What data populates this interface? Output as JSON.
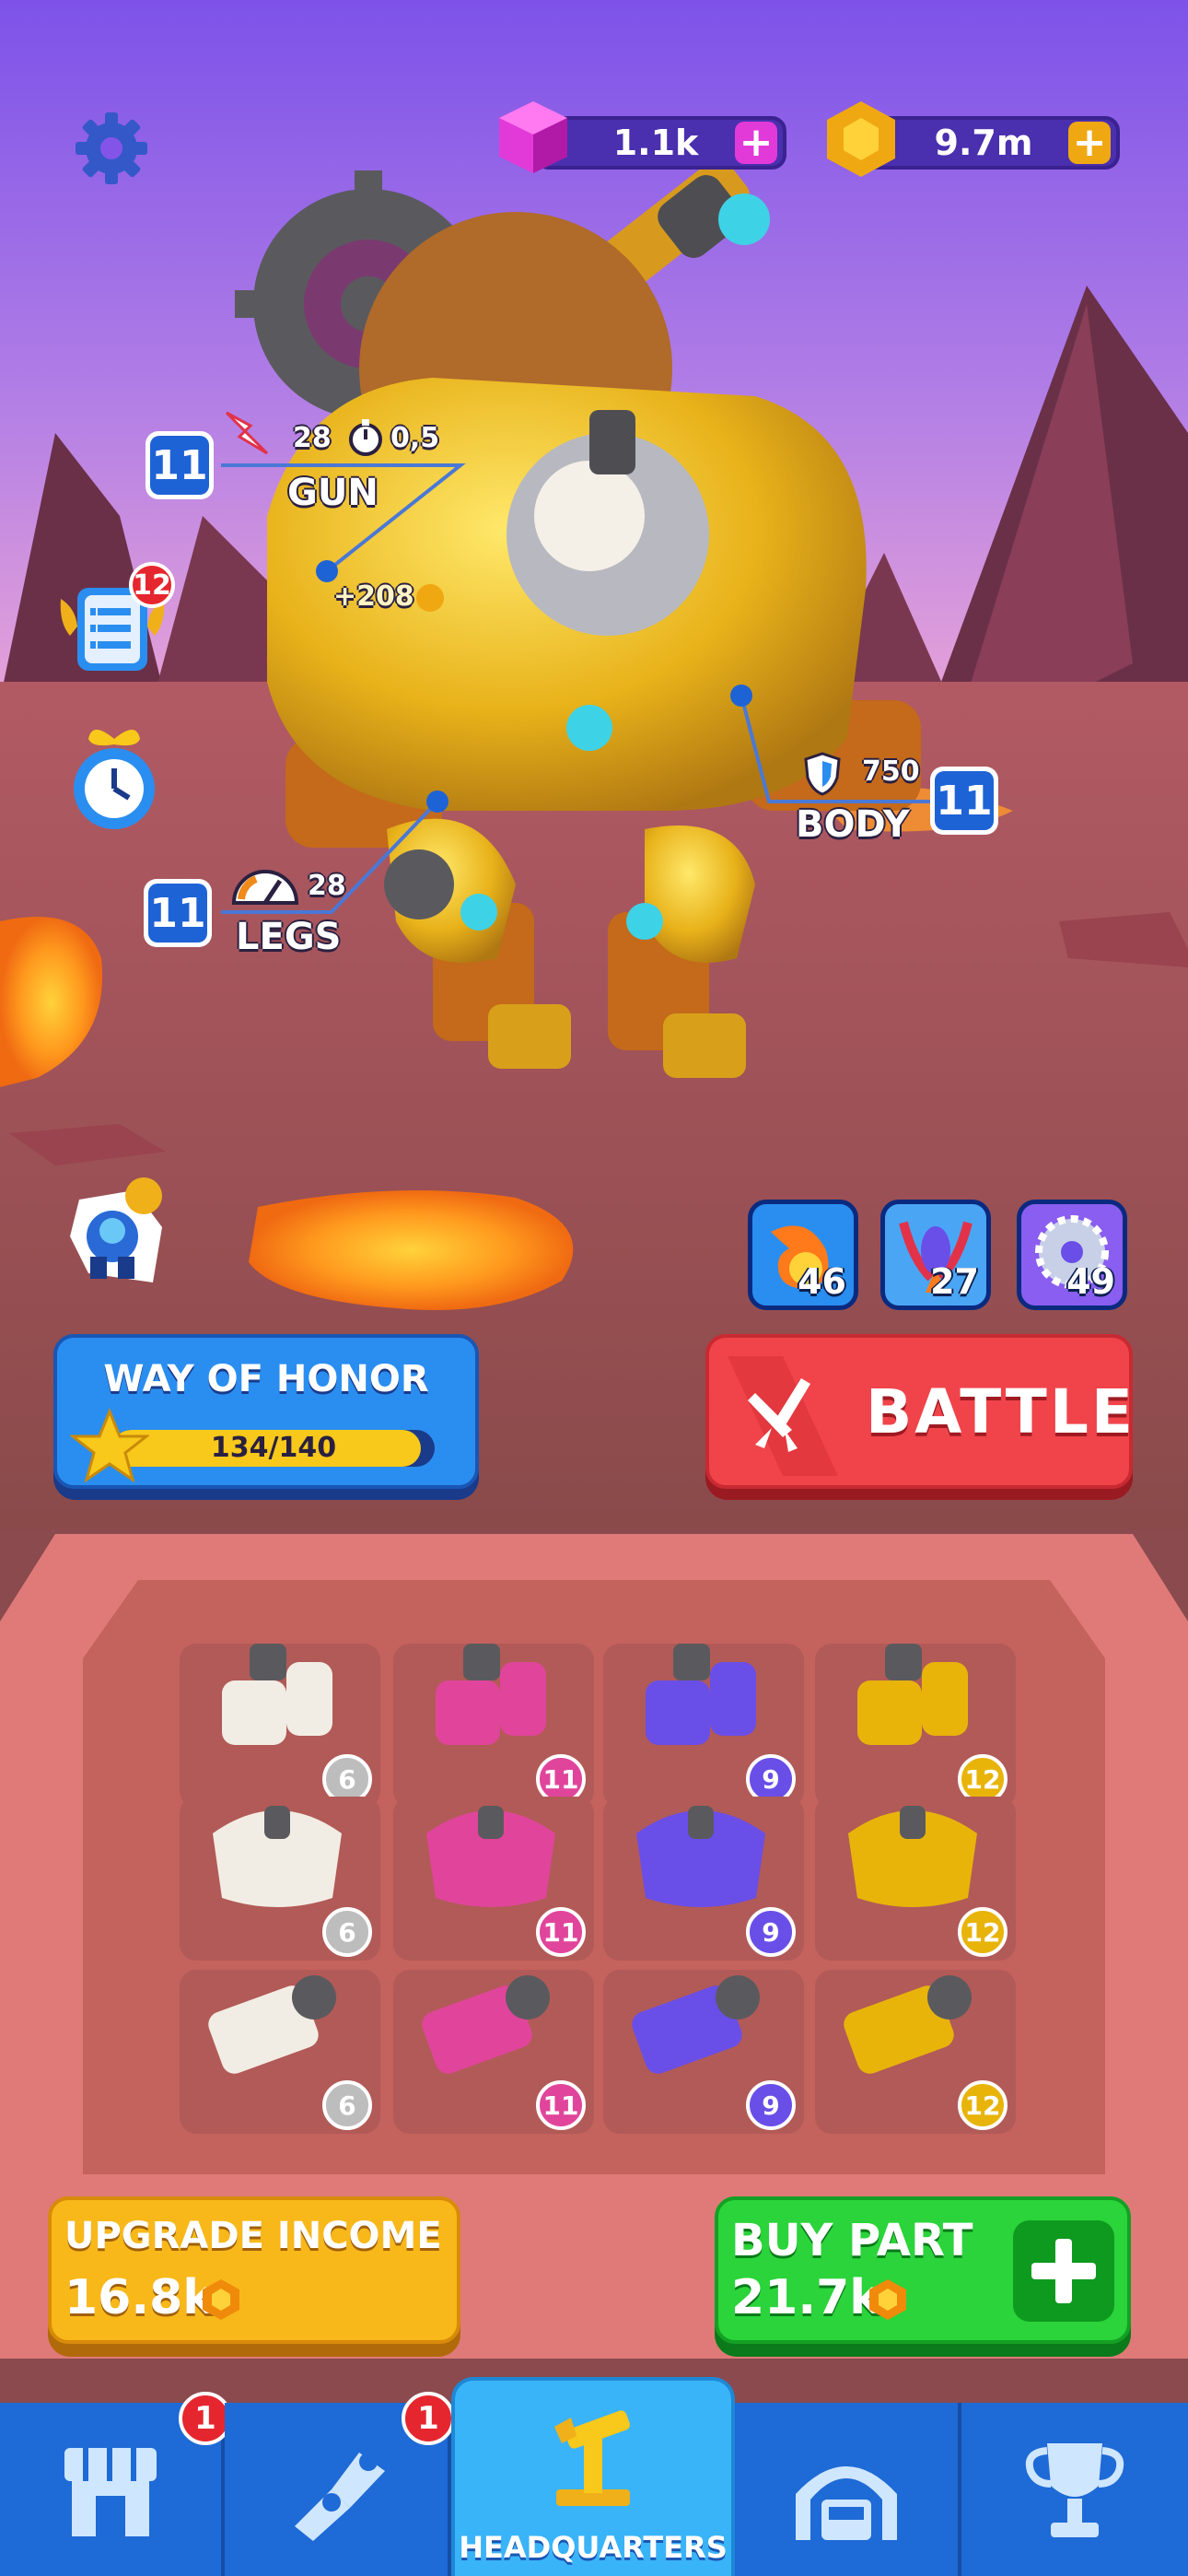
{
  "currencies": {
    "gems": {
      "value": "1.1k",
      "plus": "+"
    },
    "coins": {
      "value": "9.7m",
      "plus": "+"
    }
  },
  "robot": {
    "gun": {
      "level": "11",
      "label": "GUN",
      "damage": "28",
      "rate": "0,5",
      "income": "+208"
    },
    "body": {
      "level": "11",
      "label": "BODY",
      "armor": "750"
    },
    "legs": {
      "level": "11",
      "label": "LEGS",
      "speed": "28"
    }
  },
  "side": {
    "tasks_badge": "12"
  },
  "abilities": [
    {
      "name": "fireball",
      "value": "46",
      "color": "#ff6a2a"
    },
    {
      "name": "missiles",
      "value": "27",
      "color": "#2a8ef0"
    },
    {
      "name": "saw",
      "value": "49",
      "color": "#7a4ef0"
    }
  ],
  "way_of_honor": {
    "title": "WAY OF HONOR",
    "progress_text": "134/140",
    "current": 134,
    "max": 140
  },
  "battle": {
    "label": "BATTLE"
  },
  "inventory": [
    {
      "name": "white-legs",
      "level": "6",
      "tier": "white"
    },
    {
      "name": "pink-legs",
      "level": "11",
      "tier": "pink"
    },
    {
      "name": "purple-tracks",
      "level": "9",
      "tier": "purple"
    },
    {
      "name": "yellow-legs",
      "level": "12",
      "tier": "yellow"
    },
    {
      "name": "white-body",
      "level": "6",
      "tier": "white"
    },
    {
      "name": "pink-body",
      "level": "11",
      "tier": "pink"
    },
    {
      "name": "purple-body",
      "level": "9",
      "tier": "purple"
    },
    {
      "name": "yellow-body",
      "level": "12",
      "tier": "yellow"
    },
    {
      "name": "white-gun",
      "level": "6",
      "tier": "white"
    },
    {
      "name": "pink-gun",
      "level": "11",
      "tier": "pink"
    },
    {
      "name": "purple-gun",
      "level": "9",
      "tier": "purple"
    },
    {
      "name": "yellow-gun",
      "level": "12",
      "tier": "yellow"
    }
  ],
  "tier_colors": {
    "white": "#bdbdbd",
    "pink": "#e0459b",
    "purple": "#6a4ee8",
    "yellow": "#e8b40a"
  },
  "upgrade_income": {
    "label": "UPGRADE INCOME",
    "price": "16.8k"
  },
  "buy_part": {
    "label": "BUY PART",
    "price": "21.7k"
  },
  "nav": {
    "shop_badge": "1",
    "upgrades_badge": "1",
    "headquarters_label": "HEADQUARTERS"
  }
}
